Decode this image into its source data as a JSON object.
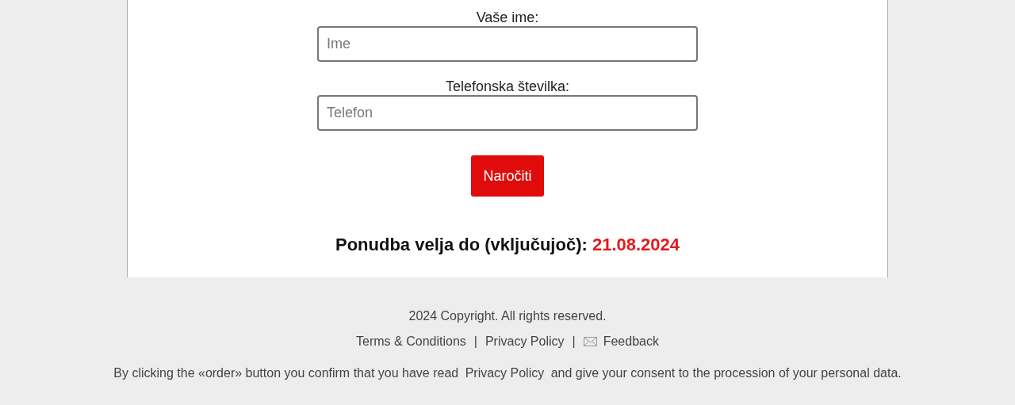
{
  "form": {
    "fields": [
      {
        "label": "Vaše ime:",
        "placeholder": "Ime"
      },
      {
        "label": "Telefonska številka:",
        "placeholder": "Telefon"
      }
    ],
    "submit": "Naročiti",
    "offer": {
      "text": "Ponudba velja do (vključujoč):",
      "date": "21.08.2024"
    }
  },
  "footer": {
    "copyright": "2024 Copyright. All rights reserved.",
    "links": [
      {
        "kind": "link",
        "text": "Terms & Conditions"
      },
      {
        "kind": "separator",
        "text": "|"
      },
      {
        "kind": "link",
        "text": "Privacy Policy"
      },
      {
        "kind": "separator",
        "text": "|"
      },
      {
        "kind": "mail",
        "text": "Feedback"
      }
    ],
    "consent": {
      "before": "By clicking the «order» button you confirm that you have read",
      "link": "Privacy Policy",
      "after": "and give your consent to the procession of your personal data."
    }
  }
}
